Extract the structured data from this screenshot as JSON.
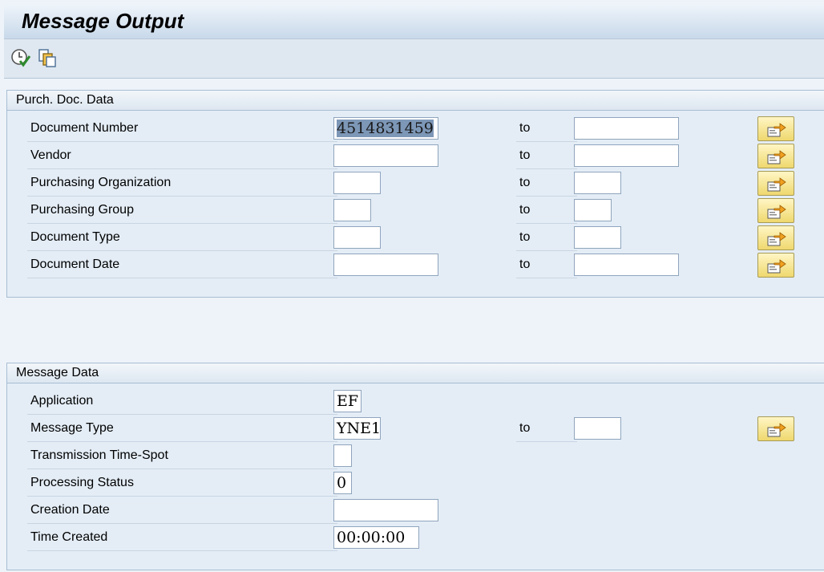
{
  "header": {
    "title": "Message Output"
  },
  "toolbar": {
    "items": [
      {
        "icon": "execute-clock-icon"
      },
      {
        "icon": "copy-documents-icon"
      }
    ]
  },
  "purch_section": {
    "title": "Purch. Doc. Data",
    "to_label": "to",
    "rows": [
      {
        "label": "Document Number",
        "from_value": "4514831459",
        "to_value": ""
      },
      {
        "label": "Vendor",
        "from_value": "",
        "to_value": ""
      },
      {
        "label": "Purchasing Organization",
        "from_value": "",
        "to_value": ""
      },
      {
        "label": "Purchasing Group",
        "from_value": "",
        "to_value": ""
      },
      {
        "label": "Document Type",
        "from_value": "",
        "to_value": ""
      },
      {
        "label": "Document Date",
        "from_value": "",
        "to_value": ""
      }
    ]
  },
  "message_section": {
    "title": "Message Data",
    "to_label": "to",
    "rows": [
      {
        "label": "Application",
        "value": "EF"
      },
      {
        "label": "Message Type",
        "value": "YNE1",
        "to_value": ""
      },
      {
        "label": "Transmission Time-Spot",
        "value": ""
      },
      {
        "label": "Processing Status",
        "value": "0"
      },
      {
        "label": "Creation Date",
        "value": ""
      },
      {
        "label": "Time Created",
        "value": "00:00:00"
      }
    ]
  },
  "colors": {
    "background": "#edf3f9",
    "button": "#f5e28a",
    "selection": "#7d97b7"
  }
}
